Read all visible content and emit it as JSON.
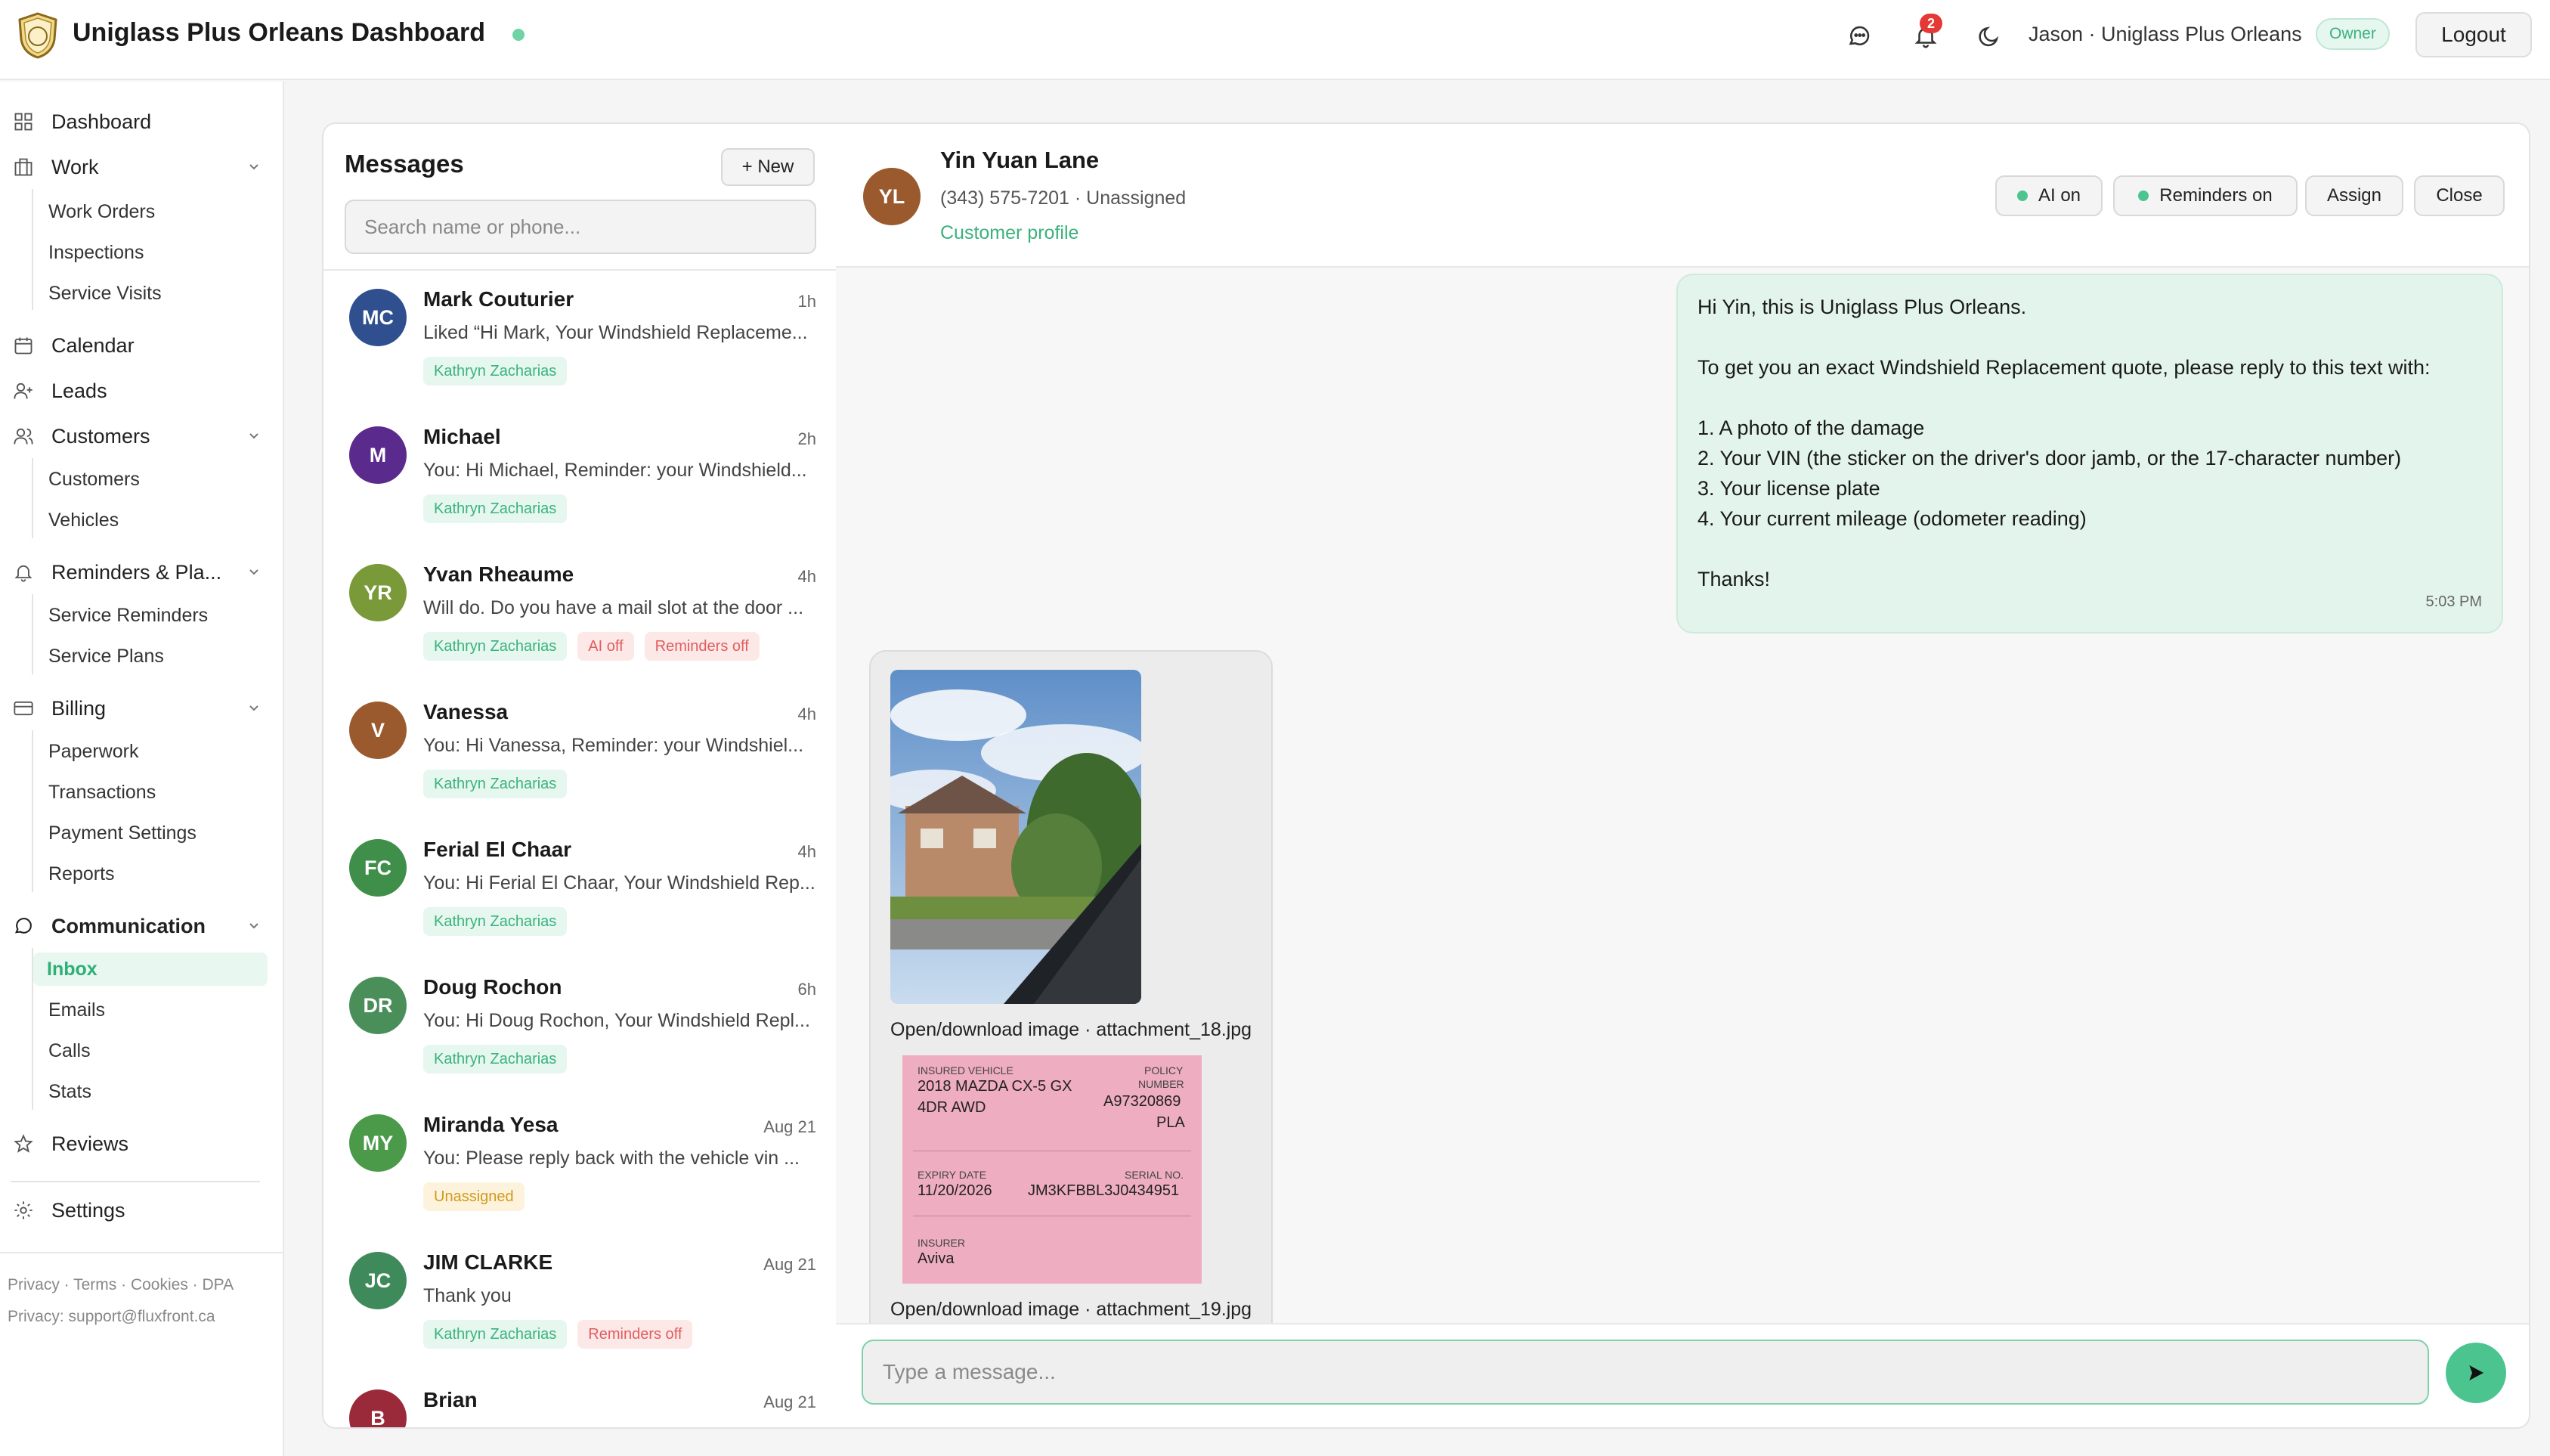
{
  "app": {
    "title": "Uniglass Plus Orleans Dashboard"
  },
  "topbar": {
    "notification_count": "2",
    "user": "Jason · Uniglass Plus Orleans",
    "role": "Owner",
    "logout": "Logout"
  },
  "sidebar": {
    "dashboard": "Dashboard",
    "work": "Work",
    "work_orders": "Work Orders",
    "inspections": "Inspections",
    "service_visits": "Service Visits",
    "calendar": "Calendar",
    "leads": "Leads",
    "customers": "Customers",
    "customers_sub": "Customers",
    "vehicles": "Vehicles",
    "reminders": "Reminders & Pla...",
    "service_reminders": "Service Reminders",
    "service_plans": "Service Plans",
    "billing": "Billing",
    "paperwork": "Paperwork",
    "transactions": "Transactions",
    "payment_settings": "Payment Settings",
    "reports": "Reports",
    "communication": "Communication",
    "inbox": "Inbox",
    "emails": "Emails",
    "calls": "Calls",
    "stats": "Stats",
    "reviews": "Reviews",
    "settings": "Settings",
    "footer_links": "Privacy · Terms · Cookies · DPA",
    "footer_privacy": "Privacy: support@fluxfront.ca"
  },
  "messages": {
    "title": "Messages",
    "new_label": "+ New",
    "search_placeholder": "Search name or phone...",
    "conversations": [
      {
        "initials": "MC",
        "name": "Mark Couturier",
        "time": "1h",
        "preview": "Liked “Hi Mark, Your Windshield Replaceme...",
        "tags": [
          "Kathryn Zacharias"
        ]
      },
      {
        "initials": "M",
        "name": "Michael",
        "time": "2h",
        "preview": "You: Hi Michael, Reminder: your Windshield...",
        "tags": [
          "Kathryn Zacharias"
        ]
      },
      {
        "initials": "YR",
        "name": "Yvan Rheaume",
        "time": "4h",
        "preview": "Will do. Do you have a mail slot at the door ...",
        "tags": [
          "Kathryn Zacharias",
          "AI off",
          "Reminders off"
        ]
      },
      {
        "initials": "V",
        "name": "Vanessa",
        "time": "4h",
        "preview": "You: Hi Vanessa, Reminder: your Windshiel...",
        "tags": [
          "Kathryn Zacharias"
        ]
      },
      {
        "initials": "FC",
        "name": "Ferial El Chaar",
        "time": "4h",
        "preview": "You: Hi Ferial El Chaar, Your Windshield Rep...",
        "tags": [
          "Kathryn Zacharias"
        ]
      },
      {
        "initials": "DR",
        "name": "Doug Rochon",
        "time": "6h",
        "preview": "You: Hi Doug Rochon, Your Windshield Repl...",
        "tags": [
          "Kathryn Zacharias"
        ]
      },
      {
        "initials": "MY",
        "name": "Miranda Yesa",
        "time": "Aug 21",
        "preview": "You: Please reply back with the vehicle vin ...",
        "tags": [
          "Unassigned"
        ]
      },
      {
        "initials": "JC",
        "name": "JIM CLARKE",
        "time": "Aug 21",
        "preview": "Thank you",
        "tags": [
          "Kathryn Zacharias",
          "Reminders off"
        ]
      },
      {
        "initials": "B",
        "name": "Brian",
        "time": "Aug 21",
        "preview": "",
        "tags": []
      }
    ]
  },
  "chat": {
    "initials": "YL",
    "name": "Yin Yuan Lane",
    "sub": "(343) 575-7201 · Unassigned",
    "profile_link": "Customer profile",
    "ai_label": "AI on",
    "reminders_label": "Reminders on",
    "assign_label": "Assign",
    "close_label": "Close",
    "outgoing": {
      "l1": "Hi Yin, this is Uniglass Plus Orleans.",
      "l2": "To get you an exact Windshield Replacement quote, please reply to this text with:",
      "l3": "1. A photo of the damage",
      "l4": "2. Your VIN (the sticker on the driver's door jamb, or the 17-character number)",
      "l5": "3. Your license plate",
      "l6": "4. Your current mileage (odometer reading)",
      "l7": "Thanks!",
      "time": "5:03 PM"
    },
    "attachment1": "Open/download image · attachment_18.jpg",
    "attachment2": "Open/download image · attachment_19.jpg",
    "doc": {
      "insured_vehicle_label": "INSURED VEHICLE",
      "vehicle_l1": "2018 MAZDA CX-5 GX",
      "vehicle_l2": "4DR AWD",
      "policy_label_1": "POLICY",
      "policy_label_2": "NUMBER",
      "policy_l1": "A97320869",
      "policy_l2": "PLA",
      "expiry_label": "EXPIRY DATE",
      "expiry": "11/20/2026",
      "serial_label": "SERIAL NO.",
      "serial": "JM3KFBBL3J0434951",
      "insurer_label": "INSURER",
      "insurer": "Aviva"
    },
    "composer_placeholder": "Type a message..."
  },
  "colors": {
    "accent": "#4cc48f",
    "avatars": [
      "#2f4f8f",
      "#5a2a8c",
      "#7a9a3a",
      "#9a5a2e",
      "#3f8f4a",
      "#4a8f5a",
      "#4a9a4a",
      "#3f8a5a",
      "#9a2a3a"
    ]
  }
}
